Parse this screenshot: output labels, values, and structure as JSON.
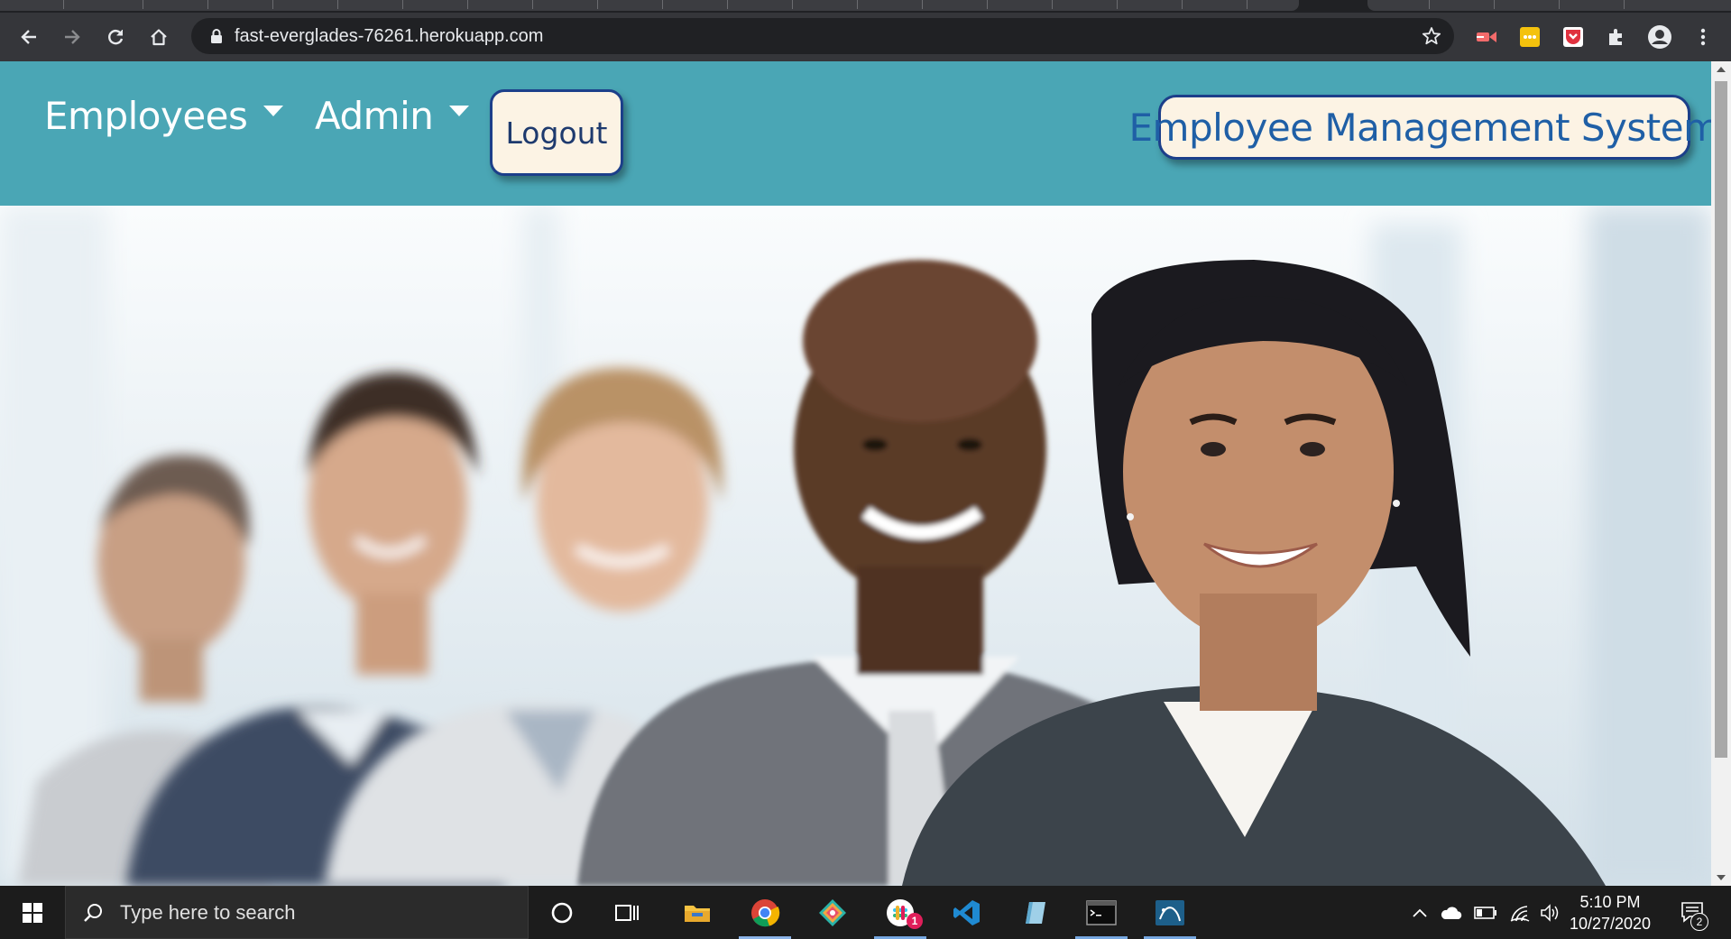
{
  "browser": {
    "url": "fast-everglades-76261.herokuapp.com"
  },
  "navbar": {
    "employees_label": "Employees",
    "admin_label": "Admin",
    "logout_label": "Logout",
    "brand_label": "Employee Management System",
    "background_color": "#4aa6b5",
    "button_background": "#fcf3e4",
    "brand_text_color": "#1f5fa6"
  },
  "hero": {
    "image_subject": "business-team-photo"
  },
  "taskbar": {
    "search_placeholder": "Type here to search",
    "slack_badge": "1",
    "clock_time": "5:10 PM",
    "clock_date": "10/27/2020",
    "notification_count": "2"
  }
}
